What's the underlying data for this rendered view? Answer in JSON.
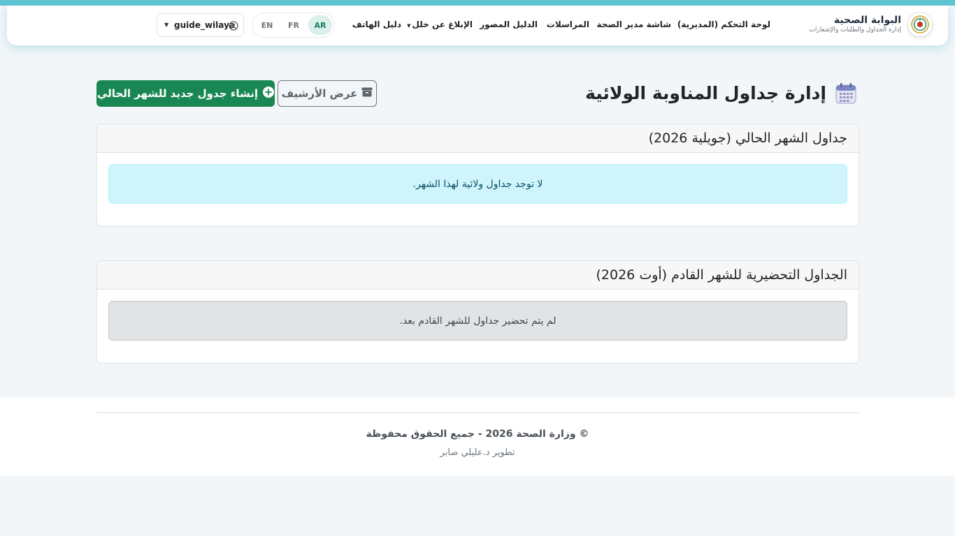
{
  "brand": {
    "title": "البوابة الصحية",
    "subtitle": "إدارة الجداول والطلبات والإشعارات",
    "logo_icon": "emblem-icon"
  },
  "nav": {
    "items": [
      {
        "label": "لوحة التحكم (المديرية)"
      },
      {
        "label": "شاشة مدير الصحة"
      },
      {
        "label": "المراسلات"
      },
      {
        "label": "الدليل المصور"
      },
      {
        "label": "الإبلاغ عن خلل"
      },
      {
        "label": "دليل الهاتف"
      }
    ],
    "report_has_dropdown": true
  },
  "languages": {
    "options": [
      "AR",
      "FR",
      "EN"
    ],
    "active": "AR"
  },
  "user": {
    "name": "guide_wilaya",
    "icon": "user-circle-icon"
  },
  "page": {
    "title": "إدارة جداول المناوبة الولائية",
    "title_icon": "calendar-icon",
    "archive_button": "عرض الأرشيف",
    "archive_icon": "archive-box-icon",
    "create_button": "إنشاء جدول جديد للشهر الحالي",
    "create_icon": "plus-circle-icon"
  },
  "current_month": {
    "header": "جداول الشهر الحالي (جويلية 2026)",
    "empty_message": "لا توجد جداول ولائية لهذا الشهر."
  },
  "next_month": {
    "header": "الجداول التحضيرية للشهر القادم (أوت 2026)",
    "empty_message": "لم يتم تحضير جداول للشهر القادم بعد."
  },
  "footer": {
    "copyright": "© وزارة الصحة 2026 - جميع الحقوق محفوظة",
    "developer": "تطوير د.عليلي صابر"
  },
  "colors": {
    "primary_green": "#198754",
    "accent_teal": "#5ec4d2",
    "info_bg": "#cff4fc",
    "secondary_bg": "#e2e3e5"
  }
}
